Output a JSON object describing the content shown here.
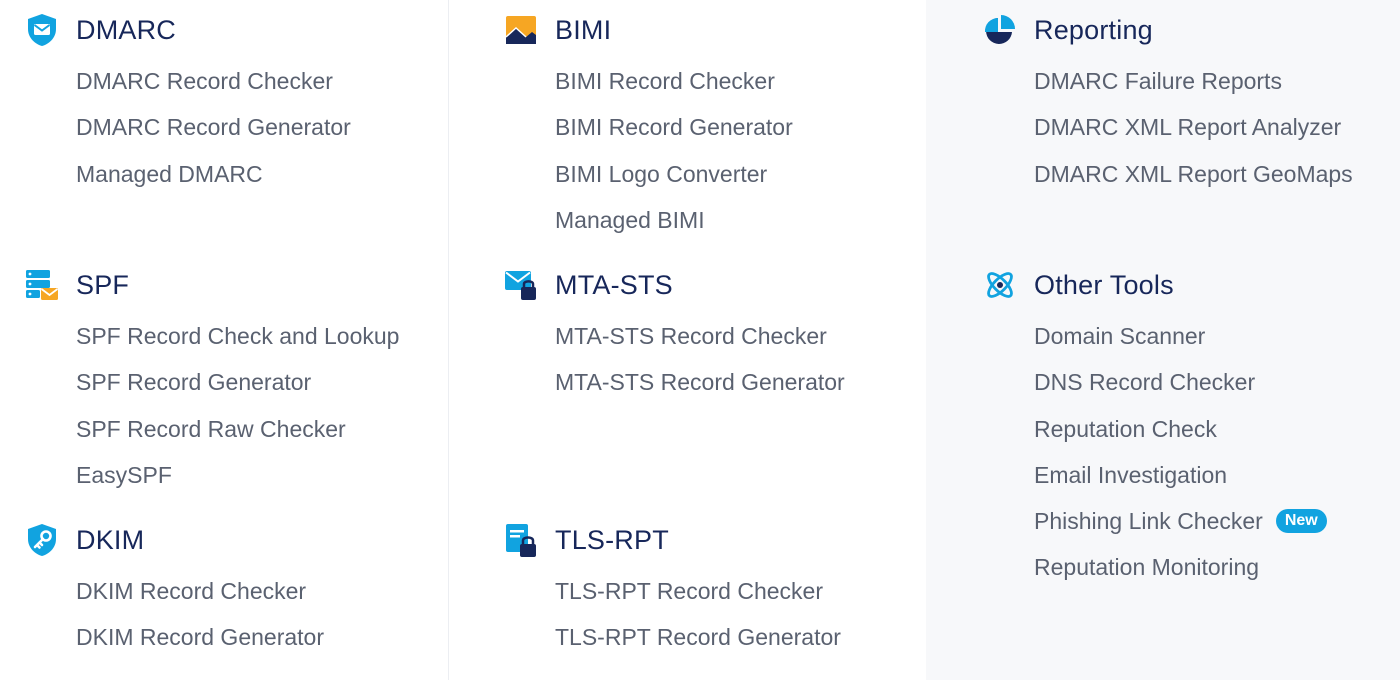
{
  "colors": {
    "title": "#17275a",
    "item": "#5a6170",
    "accent": "#11a3e0",
    "navy": "#17275a",
    "orange": "#f6a623"
  },
  "sections": {
    "dmarc": {
      "title": "DMARC",
      "icon": "shield-mail-icon",
      "items": [
        "DMARC Record Checker",
        "DMARC Record Generator",
        "Managed DMARC"
      ]
    },
    "spf": {
      "title": "SPF",
      "icon": "server-mail-icon",
      "items": [
        "SPF Record Check and Lookup",
        "SPF Record Generator",
        "SPF Record Raw Checker",
        "EasySPF"
      ]
    },
    "dkim": {
      "title": "DKIM",
      "icon": "shield-key-icon",
      "items": [
        "DKIM Record Checker",
        "DKIM Record Generator"
      ]
    },
    "bimi": {
      "title": "BIMI",
      "icon": "image-logo-icon",
      "items": [
        "BIMI Record Checker",
        "BIMI Record Generator",
        "BIMI Logo Converter",
        "Managed BIMI"
      ]
    },
    "mtasts": {
      "title": "MTA-STS",
      "icon": "mail-lock-icon",
      "items": [
        "MTA-STS Record Checker",
        "MTA-STS Record Generator"
      ]
    },
    "tlsrpt": {
      "title": "TLS-RPT",
      "icon": "document-lock-icon",
      "items": [
        "TLS-RPT Record Checker",
        "TLS-RPT Record Generator"
      ]
    },
    "reporting": {
      "title": "Reporting",
      "icon": "pie-chart-icon",
      "items": [
        "DMARC Failure Reports",
        "DMARC XML Report Analyzer",
        "DMARC XML Report GeoMaps"
      ]
    },
    "other": {
      "title": "Other Tools",
      "icon": "atom-icon",
      "items": [
        "Domain Scanner",
        "DNS Record Checker",
        "Reputation Check",
        "Email Investigation",
        "Phishing Link Checker",
        "Reputation Monitoring"
      ],
      "badge": "New"
    }
  }
}
